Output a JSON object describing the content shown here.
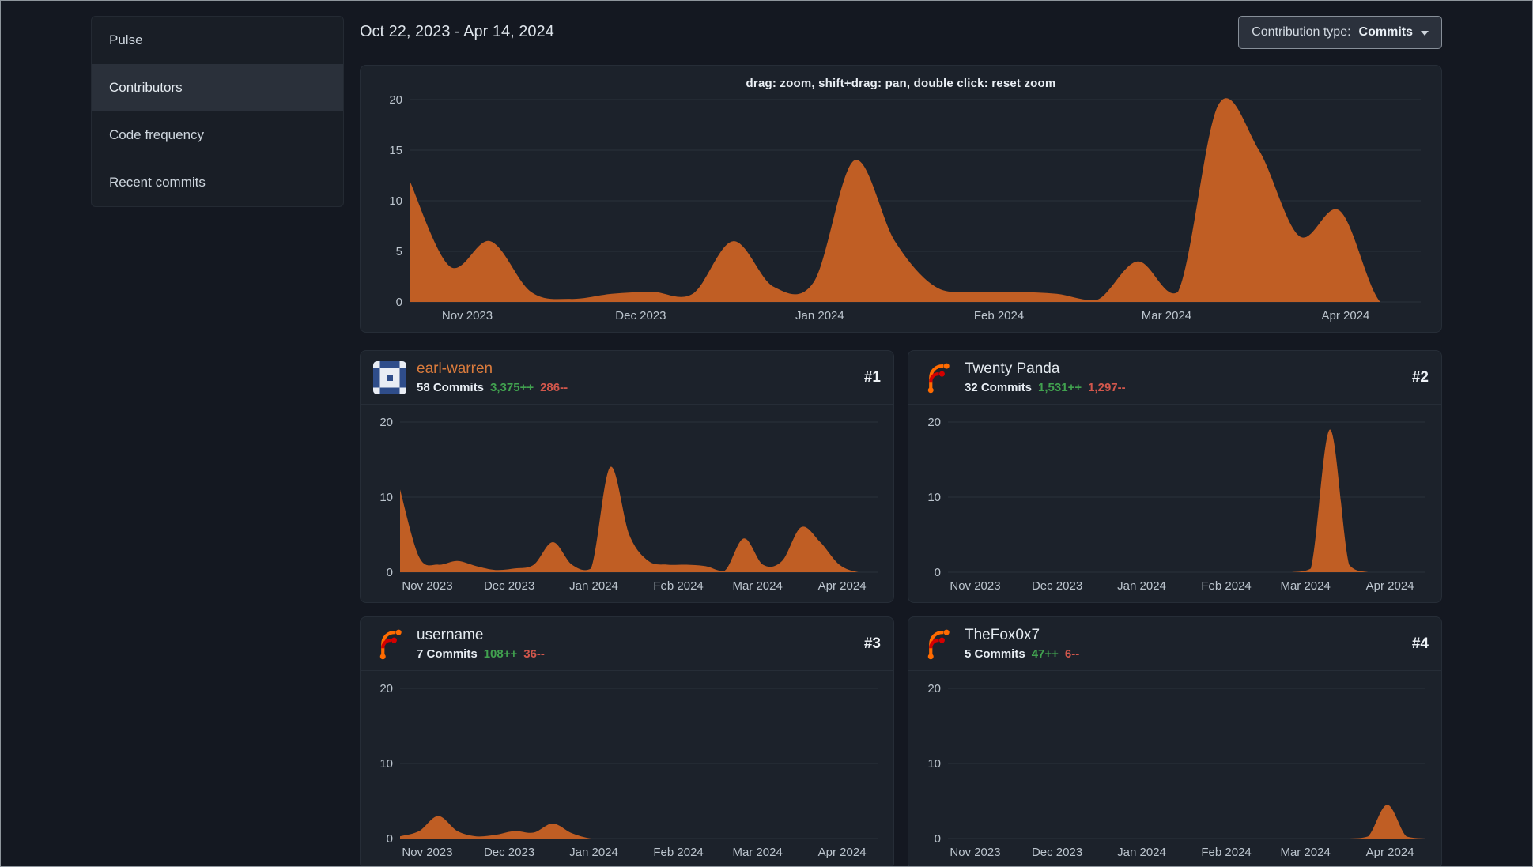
{
  "sidebar": {
    "items": [
      {
        "label": "Pulse",
        "active": false
      },
      {
        "label": "Contributors",
        "active": true
      },
      {
        "label": "Code frequency",
        "active": false
      },
      {
        "label": "Recent commits",
        "active": false
      }
    ]
  },
  "header": {
    "date_range": "Oct 22, 2023 - Apr 14, 2024",
    "contribution_type_label": "Contribution type:",
    "contribution_type_value": "Commits"
  },
  "contributors": [
    {
      "name": "earl-warren",
      "rank": "#1",
      "commits": "58 Commits",
      "additions": "3,375++",
      "deletions": "286--",
      "avatar": "identicon-blue"
    },
    {
      "name": "Twenty Panda",
      "rank": "#2",
      "commits": "32 Commits",
      "additions": "1,531++",
      "deletions": "1,297--",
      "avatar": "forgejo-logo"
    },
    {
      "name": "username",
      "rank": "#3",
      "commits": "7 Commits",
      "additions": "108++",
      "deletions": "36--",
      "avatar": "forgejo-logo"
    },
    {
      "name": "TheFox0x7",
      "rank": "#4",
      "commits": "5 Commits",
      "additions": "47++",
      "deletions": "6--",
      "avatar": "forgejo-logo"
    }
  ],
  "colors": {
    "chart_fill": "#c05e24",
    "additions_green": "#41a14f",
    "deletions_red": "#d2574c",
    "link_orange": "#da7b3c"
  },
  "chart_data": [
    {
      "type": "area",
      "name": "all-contributors-weekly-commits",
      "hint": "drag: zoom, shift+drag: pan, double click: reset zoom",
      "x_labels": [
        "Nov 2023",
        "Dec 2023",
        "Jan 2024",
        "Feb 2024",
        "Mar 2024",
        "Apr 2024"
      ],
      "y_ticks": [
        0,
        5,
        10,
        15,
        20
      ],
      "ylim": [
        0,
        20
      ],
      "values": [
        12,
        3.5,
        6,
        1,
        0.3,
        0.8,
        1,
        0.8,
        6,
        1.5,
        2,
        14,
        6,
        1.5,
        1,
        1,
        0.8,
        0.2,
        4,
        1,
        19.5,
        15,
        6.5,
        9,
        0,
        0
      ],
      "color": "#c05e24"
    },
    {
      "type": "area",
      "name": "earl-warren-weekly-commits",
      "x_labels": [
        "Nov 2023",
        "Dec 2023",
        "Jan 2024",
        "Feb 2024",
        "Mar 2024",
        "Apr 2024"
      ],
      "y_ticks": [
        0,
        10,
        20
      ],
      "ylim": [
        0,
        20
      ],
      "values": [
        11,
        2,
        1,
        1.5,
        0.8,
        0.3,
        0.5,
        1,
        4,
        1,
        0.5,
        14,
        5,
        1.5,
        1,
        1,
        0.8,
        0.2,
        4.5,
        1,
        1.5,
        6,
        4,
        1,
        0,
        0
      ],
      "color": "#c05e24"
    },
    {
      "type": "area",
      "name": "twenty-panda-weekly-commits",
      "x_labels": [
        "Nov 2023",
        "Dec 2023",
        "Jan 2024",
        "Feb 2024",
        "Mar 2024",
        "Apr 2024"
      ],
      "y_ticks": [
        0,
        10,
        20
      ],
      "ylim": [
        0,
        20
      ],
      "values": [
        0,
        0,
        0,
        0,
        0,
        0,
        0,
        0,
        0,
        0,
        0,
        0,
        0,
        0,
        0,
        0,
        0,
        0,
        0,
        0.5,
        19,
        1,
        0,
        0,
        0,
        0
      ],
      "color": "#c05e24"
    },
    {
      "type": "area",
      "name": "username-weekly-commits",
      "x_labels": [
        "Nov 2023",
        "Dec 2023",
        "Jan 2024",
        "Feb 2024",
        "Mar 2024",
        "Apr 2024"
      ],
      "y_ticks": [
        0,
        10,
        20
      ],
      "ylim": [
        0,
        20
      ],
      "values": [
        0.3,
        1,
        3,
        1,
        0.3,
        0.5,
        1,
        0.8,
        2,
        0.7,
        0,
        0,
        0,
        0,
        0,
        0,
        0,
        0,
        0,
        0,
        0,
        0,
        0,
        0,
        0,
        0
      ],
      "color": "#c05e24"
    },
    {
      "type": "area",
      "name": "thefox0x7-weekly-commits",
      "x_labels": [
        "Nov 2023",
        "Dec 2023",
        "Jan 2024",
        "Feb 2024",
        "Mar 2024",
        "Apr 2024"
      ],
      "y_ticks": [
        0,
        10,
        20
      ],
      "ylim": [
        0,
        20
      ],
      "values": [
        0,
        0,
        0,
        0,
        0,
        0,
        0,
        0,
        0,
        0,
        0,
        0,
        0,
        0,
        0,
        0,
        0,
        0,
        0,
        0,
        0,
        0,
        0.3,
        4.5,
        0.3,
        0
      ],
      "color": "#c05e24"
    }
  ]
}
